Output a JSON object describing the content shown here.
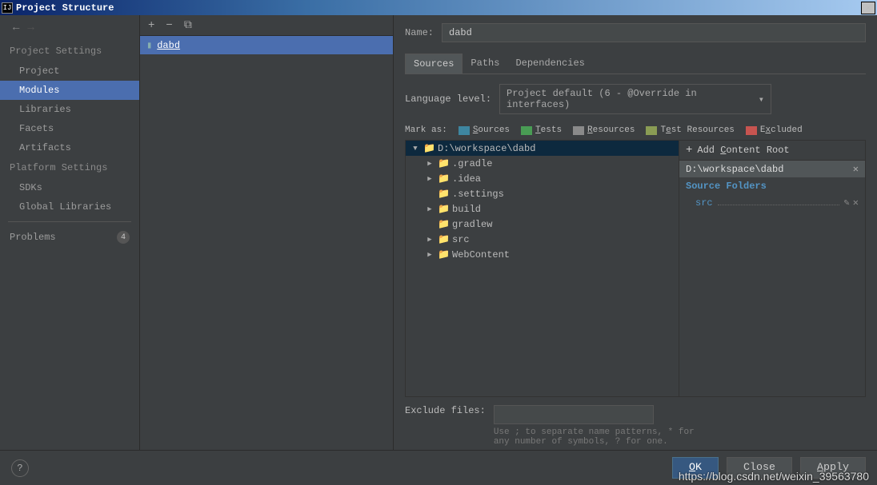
{
  "title": "Project Structure",
  "sidebar": {
    "section1": "Project Settings",
    "items1": [
      "Project",
      "Modules",
      "Libraries",
      "Facets",
      "Artifacts"
    ],
    "section2": "Platform Settings",
    "items2": [
      "SDKs",
      "Global Libraries"
    ],
    "problems_label": "Problems",
    "problems_count": "4"
  },
  "module_name": "dabd",
  "name_label": "Name:",
  "tabs": [
    "Sources",
    "Paths",
    "Dependencies"
  ],
  "lang_label": "Language level:",
  "lang_value": "Project default (6 - @Override in interfaces)",
  "mark_label": "Mark as:",
  "marks": [
    {
      "label": "Sources",
      "color": "#3e86a0"
    },
    {
      "label": "Tests",
      "color": "#499c54"
    },
    {
      "label": "Resources",
      "color": "#8a8a8a"
    },
    {
      "label": "Test Resources",
      "color": "#8a9c54"
    },
    {
      "label": "Excluded",
      "color": "#c75450"
    }
  ],
  "tree_root": "D:\\workspace\\dabd",
  "tree_items": [
    {
      "name": ".gradle",
      "expandable": true,
      "color": "#8a8a8a"
    },
    {
      "name": ".idea",
      "expandable": true,
      "color": "#8a8a8a"
    },
    {
      "name": ".settings",
      "expandable": false,
      "color": "#8a8a8a"
    },
    {
      "name": "build",
      "expandable": true,
      "color": "#8a8a8a"
    },
    {
      "name": "gradlew",
      "expandable": false,
      "color": "#8a8a8a"
    },
    {
      "name": "src",
      "expandable": true,
      "color": "#3e86a0"
    },
    {
      "name": "WebContent",
      "expandable": true,
      "color": "#8a8a8a"
    }
  ],
  "add_content_root": "Add Content Root",
  "content_root_path": "D:\\workspace\\dabd",
  "source_folders_header": "Source Folders",
  "source_folder": "src",
  "exclude_label": "Exclude files:",
  "exclude_hint": "Use ; to separate name patterns, * for any number of symbols, ? for one.",
  "buttons": {
    "ok": "OK",
    "cancel": "Close",
    "apply": "Apply"
  },
  "watermark": "https://blog.csdn.net/weixin_39563780"
}
